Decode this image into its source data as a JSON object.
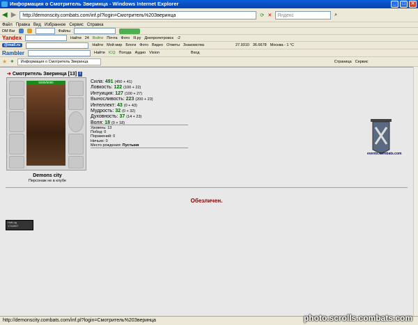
{
  "window": {
    "title": "Информация о Смотритель Зверинца - Windows Internet Explorer"
  },
  "menu": [
    "Файл",
    "Правка",
    "Вид",
    "Избранное",
    "Сервис",
    "Справка"
  ],
  "address": {
    "url": "http://demonscity.combats.com/inf.pl?login=Смотритель%20Зверинца",
    "search_placeholder": "Яндекс"
  },
  "tb_dm": {
    "label": "DM Bar",
    "files": "Файлы",
    "enter": "Войти",
    "mail": "Почта",
    "flights": "Фото",
    "ya": "Я.ру",
    "city": "Днепропетровск",
    "temp": "-2"
  },
  "tb_yandex": {
    "brand": "Yandex",
    "find": "Найти",
    "count": "24"
  },
  "tb_mail": {
    "brand": "@mail.ru",
    "find": "Найти",
    "items": [
      "Мой мир",
      "Блоги",
      "Фото",
      "Видео",
      "Ответы",
      "Знакомства"
    ],
    "usd": "27.9310",
    "eur": "36.6678",
    "weather": "Москва - 1 °C"
  },
  "tb_rambler": {
    "brand": "Rambler",
    "find": "Найти",
    "items": [
      "ICQ",
      "Погода",
      "Аудио",
      "Vision",
      "Вход"
    ]
  },
  "tab": {
    "label": "Информация о Смотритель Зверинца"
  },
  "tab_right": {
    "page": "Страница",
    "tools": "Сервис"
  },
  "colors": {
    "accent": "#0a5fd8",
    "stat": "#006400",
    "depers": "#8b0000"
  },
  "character": {
    "name": "Смотритель Зверинца",
    "level": "[13]",
    "hp": "5080/5080",
    "stats": [
      {
        "label": "Сила:",
        "value": "491",
        "extra": "(450 + 41)"
      },
      {
        "label": "Ловкость:",
        "value": "122",
        "extra": "(100 + 22)"
      },
      {
        "label": "Интуиция:",
        "value": "127",
        "extra": "(100 + 27)"
      },
      {
        "label": "Выносливость:",
        "value": "223",
        "extra": "(200 + 23)"
      },
      {
        "label": "Интеллект:",
        "value": "43",
        "extra": "(0 + 43)"
      },
      {
        "label": "Мудрость:",
        "value": "32",
        "extra": "(0 + 32)"
      },
      {
        "label": "Духовность:",
        "value": "37",
        "extra": "(14 + 23)"
      },
      {
        "label": "Воля:",
        "value": "18",
        "extra": "(0 + 18)"
      }
    ],
    "info": [
      "Уровень: 13",
      "Побед: 0",
      "Поражений: 0",
      "Ничьих: 0"
    ],
    "birth_label": "Место рождения:",
    "birth_value": "Пустыня",
    "clan": "Demons city",
    "club": "Персонаж не в клубе"
  },
  "banner": {
    "link": "events.combats.com"
  },
  "depersonalized": "Обезличен.",
  "counter": {
    "line1": "HotLog",
    "line2": "1744007"
  },
  "status": {
    "text": "http://demonscity.combats.com/inf.pl?login=Смотритель%20Зверинца"
  },
  "watermark": "photo.scrolls.combats.com"
}
